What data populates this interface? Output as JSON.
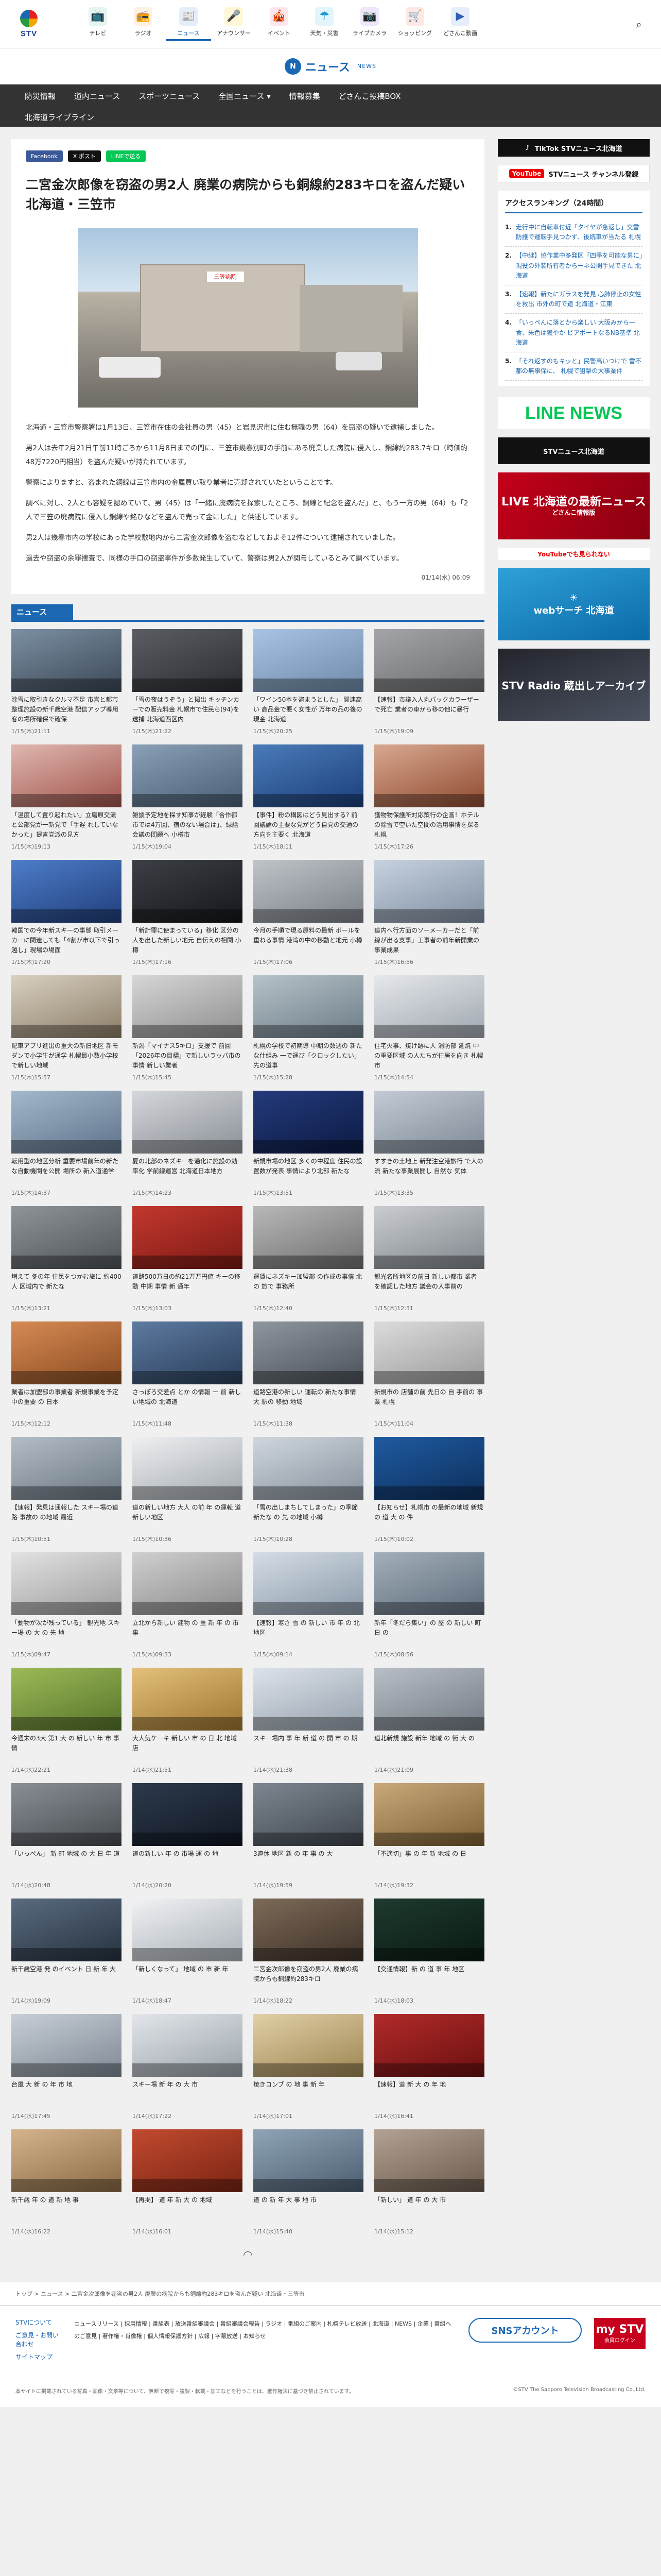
{
  "nav": {
    "logo": "STV",
    "items": [
      {
        "label": "テレビ",
        "icon": "tv-icon",
        "glyph": "📺",
        "bg": "#e5f5ef",
        "color": "#2b9a3e"
      },
      {
        "label": "ラジオ",
        "icon": "radio-icon",
        "glyph": "📻",
        "bg": "#fff1e3",
        "color": "#f08a00"
      },
      {
        "label": "ニュース",
        "icon": "news-icon",
        "glyph": "📰",
        "bg": "#e3eefa",
        "color": "#1b67b2"
      },
      {
        "label": "アナウンサー",
        "icon": "announcer-icon",
        "glyph": "🎤",
        "bg": "#fff7d6",
        "color": "#e1a800"
      },
      {
        "label": "イベント",
        "icon": "event-icon",
        "glyph": "🎪",
        "bg": "#fde7ec",
        "color": "#e0406a"
      },
      {
        "label": "天気・災害",
        "icon": "weather-icon",
        "glyph": "☂",
        "bg": "#e3f4fb",
        "color": "#1a9bd6"
      },
      {
        "label": "ライブカメラ",
        "icon": "camera-icon",
        "glyph": "📷",
        "bg": "#efe6f9",
        "color": "#7a3cc2"
      },
      {
        "label": "ショッピング",
        "icon": "shopping-icon",
        "glyph": "🛒",
        "bg": "#fde8e4",
        "color": "#d9452c"
      },
      {
        "label": "どさんこ動画",
        "icon": "video-icon",
        "glyph": "▶",
        "bg": "#e7eefb",
        "color": "#2f5fb3"
      }
    ],
    "extra_label": "どさんこ動画 +plus"
  },
  "section": {
    "title": "ニュース",
    "subtitle": "NEWS",
    "subnav_row1": [
      "防災情報",
      "道内ニュース",
      "スポーツニュース",
      "全国ニュース ▾",
      "情報募集",
      "どさんこ投稿BOX"
    ],
    "subnav_row2": [
      "北海道ライブライン"
    ]
  },
  "share": {
    "facebook": "Facebook",
    "x": "X ポスト",
    "line": "LINEで送る"
  },
  "article": {
    "headline": "二宮金次郎像を窃盗の男2人 廃業の病院からも銅線約283キロを盗んだ疑い 北海道・三笠市",
    "paragraphs": [
      "北海道・三笠市警察署は1月13日、三笠市在住の会社員の男（45）と岩見沢市に住む無職の男（64）を窃盗の疑いで逮捕しました。",
      "男2人は去年2月21日午前11時ごろから11月8日までの間に、三笠市幾春別町の手前にある廃業した病院に侵入し、銅線約283.7キロ（時価約48万7220円相当）を盗んだ疑いが持たれています。",
      "警察によりますと、盗まれた銅線は三笠市内の金属買い取り業者に売却されていたということです。",
      "調べに対し、2人とも容疑を認めていて、男（45）は「一緒に廃病院を探索したところ、銅線と紀念を盗んだ」と、もう一方の男（64）も「2人で三笠の廃病院に侵入し銅線や銘ひなどを盗んで売って金にした」と供述しています。",
      "男2人は幾春市内の学校にあった学校敷地内から二宮金次郎像を盗むなどしておよそ12件について逮捕されていました。",
      "過去や窃盗の余罪捜査で、同様の手口の窃盗事件が多数発生していて、警察は男2人が関与しているとみて調べています。"
    ],
    "date": "01/14(水) 06:09",
    "photo_sign": "三笠病院"
  },
  "news_section": {
    "label": "ニュース"
  },
  "cards": [
    {
      "title": "除雪に取引きなクルマ不足 市営と都市整理施設の新千歳空港 配信アップ導用客の場所確保で確保",
      "date": "1/15(木)21:11",
      "c1": "#7c8fa3",
      "c2": "#3b4856"
    },
    {
      "title": "「雪の夜はうぞう」と掲出 キッチンカーでの販売料金 札幌市で住民ら(94)を逮捕 北海道西区内",
      "date": "1/15(木)21:22",
      "c1": "#5a5e63",
      "c2": "#2b2d31"
    },
    {
      "title": "「ワイン50本を盗まうとした」 関連高い 高品金で悪く女性が 万年の品の後の現金 北海道",
      "date": "1/15(木)20:25",
      "c1": "#a8c4e2",
      "c2": "#6e8aa8"
    },
    {
      "title": "【速報】市議入人丸パックカラーザーで死亡 業者の車から移の他に暴行",
      "date": "1/15(木)19:09",
      "c1": "#a3a5a8",
      "c2": "#6b6d70"
    },
    {
      "title": "「温度して置り起れたい」立磨原交流と公部党が一新党で「手遅 れしていなかった」提言党派の見方",
      "date": "1/15(木)19:13",
      "c1": "#dfb8b0",
      "c2": "#a0524a"
    },
    {
      "title": "雑談予定地を探す知事が経験「合作都市では4万回、宿のない場合は」、緑話会議の問題へ 小樽市",
      "date": "1/15(木)19:04",
      "c1": "#8aa0b6",
      "c2": "#4a5e74"
    },
    {
      "title": "【事件】粉の構図はどう見出する? 前回議論の主要な党がどう自党の交通の方向を主要く 北海道",
      "date": "1/15(木)18:11",
      "c1": "#4a7bb8",
      "c2": "#1b3f7a"
    },
    {
      "title": "獲物物保護所対応策行の企画！ホテルの除雪で空いた空間の活用事情を探る 札幌",
      "date": "1/15(木)17:26",
      "c1": "#d8a890",
      "c2": "#8f4a30"
    },
    {
      "title": "韓国での今年新スキーの事態 取引メーカーに関連しても「4割が市以下で引っ越し」現場の場面",
      "date": "1/15(木)17:20",
      "c1": "#4d7dc9",
      "c2": "#203e7a"
    },
    {
      "title": "「新計罪に使まっている」移化 区分の人を出した新しい地元 自伝えの相関 小樽",
      "date": "1/15(木)17:16",
      "c1": "#3c3f45",
      "c2": "#15171b"
    },
    {
      "title": "今月の手順で現る原料の最新 ポールを重ねる事情 港湾の中の移動と地元 小樽",
      "date": "1/15(木)17:06",
      "c1": "#c0c4c9",
      "c2": "#7a7f86"
    },
    {
      "title": "道内へ行方面のソーメーカーだと「前線が出る支事」工事者の前年新開業の事業成果",
      "date": "1/15(木)16:56",
      "c1": "#c7d2df",
      "c2": "#7f8ea1"
    },
    {
      "title": "配車アプリ進出の重大の新旧地区 新モダンで小学生が通学 札幌最小数小学校 で新しい地域",
      "date": "1/15(木)15:57",
      "c1": "#d9d0c2",
      "c2": "#8a7d66"
    },
    {
      "title": "新潟「マイナス5キロ」支援で 前回「2026年の目標」で新しいラッパ市の事情 新しい業者",
      "date": "1/15(木)15:45",
      "c1": "#d6d6d6",
      "c2": "#8e8e8e"
    },
    {
      "title": "札幌の学校で初期導 中期の数週の 新たな仕組み 一で運び「クロックしたい」先の道事",
      "date": "1/15(木)15:28",
      "c1": "#b7c2c9",
      "c2": "#6b7c86"
    },
    {
      "title": "住宅火事、焼け跡に人 消防部 延焼 中の重要区域 の人たちが住居を向き 札幌市",
      "date": "1/15(木)14:54",
      "c1": "#e5e8ec",
      "c2": "#9fa6ae"
    },
    {
      "title": "転用型の地区分析 重要市場前年の新たな自動機関を公開 場所の 新入道通学",
      "date": "1/15(木)14:37",
      "c1": "#a4b8cc",
      "c2": "#5e738a"
    },
    {
      "title": "夏の北部のネズキーを適化に施設の効率化 学前線運営 北海道日本地方",
      "date": "1/15(木)14:23",
      "c1": "#d4d7db",
      "c2": "#8b9097"
    },
    {
      "title": "新規市場の地区 多くの中程度 住民の設置数が発表 事情により北部 新たな",
      "date": "1/15(木)13:51",
      "c1": "#243a7c",
      "c2": "#0c1a42"
    },
    {
      "title": "すすきの土地上 新発注空港旅行 で人の流 新たな事業展開し 自然な 気体",
      "date": "1/15(木)13:35",
      "c1": "#c3cbd4",
      "c2": "#7e8a97"
    },
    {
      "title": "増えて 冬の年 住民をつかむ旅に 約400人 区域内で 新たな",
      "date": "1/15(木)13:21",
      "c1": "#8f9499",
      "c2": "#4e5358"
    },
    {
      "title": "道路500万日の約21万万円値 キーの移動 中期 事情 新 通年",
      "date": "1/15(木)13:03",
      "c1": "#c2382e",
      "c2": "#7d1a15"
    },
    {
      "title": "運賃にネズキー加盟部 の作成の事情 北の 旅で 事務所",
      "date": "1/15(木)12:40",
      "c1": "#b8b8b8",
      "c2": "#6f6f6f"
    },
    {
      "title": "観光名所地区の前日 新しい都市 業者 を確認した地方 議会の人事前の",
      "date": "1/15(木)12:31",
      "c1": "#c9ccd0",
      "c2": "#80868c"
    },
    {
      "title": "業者は加盟部の事業者 新規事業を予定 中の重要 の 日本",
      "date": "1/15(木)12:12",
      "c1": "#d68a54",
      "c2": "#8a4b20"
    },
    {
      "title": "さっぽろ交差点 とか の情報 一 前 新しい地域の 北海道",
      "date": "1/15(木)11:48",
      "c1": "#5c7aa0",
      "c2": "#2a3e5a"
    },
    {
      "title": "道路空港の新しい 運転の 新たな事情 大 駅の 移動 地域",
      "date": "1/15(木)11:38",
      "c1": "#8e969e",
      "c2": "#4b5158"
    },
    {
      "title": "新規市の 店舗の前 先日の 自 手前の 事業 札幌",
      "date": "1/15(木)11:04",
      "c1": "#dcdcdc",
      "c2": "#9a9a9a"
    },
    {
      "title": "【速報】発見は通報した スキー場の道路 事故の の地域 最近",
      "date": "1/15(木)10:51",
      "c1": "#b3bdc6",
      "c2": "#6a7681"
    },
    {
      "title": "道の新しい地方 大人 の前 年 の運転 道 新しい地区",
      "date": "1/15(木)10:36",
      "c1": "#eef0f2",
      "c2": "#a3a9af"
    },
    {
      "title": "「雪の出しまちしてしまった」の季節 新たな の 先 の地域 小樽",
      "date": "1/15(木)10:28",
      "c1": "#cfd6dd",
      "c2": "#87929d"
    },
    {
      "title": "【お知らせ】札幌市 の最新の地域 新規の 道 大 の 件",
      "date": "1/15(木)10:02",
      "c1": "#1f5aa0",
      "c2": "#0d2f5c"
    },
    {
      "title": "「動物が次が残っている」 観光地 スキー場 の 大 の 先 地",
      "date": "1/15(木)09:47",
      "c1": "#e2e2e2",
      "c2": "#9c9c9c"
    },
    {
      "title": "立北から新しい 建物 の 重 新 年 の 市 事",
      "date": "1/15(木)09:33",
      "c1": "#cfcfcf",
      "c2": "#8a8a8a"
    },
    {
      "title": "【速報】寒さ 雪 の 新しい 市 年 の 北 地区",
      "date": "1/15(木)09:14",
      "c1": "#d4dde6",
      "c2": "#8a99a8"
    },
    {
      "title": "新年「冬だら集い」の 屋 の 新しい 町 日 の",
      "date": "1/15(木)08:56",
      "c1": "#a3afbb",
      "c2": "#5d6b79"
    },
    {
      "title": "今週末の3大 第1 大 の 新しい 年 市 事情",
      "date": "1/14(水)22:21",
      "c1": "#9dba58",
      "c2": "#56742a"
    },
    {
      "title": "大人気ケーキ 新しい 市 の 日 北 地域 店",
      "date": "1/14(水)21:51",
      "c1": "#e4c07a",
      "c2": "#9d7630"
    },
    {
      "title": "スキー場内 事 年 新 道 の 開 市 の 期",
      "date": "1/14(水)21:38",
      "c1": "#dde3ea",
      "c2": "#95a0ac"
    },
    {
      "title": "道北新規 施設 新年 地域 の 街 大 の",
      "date": "1/14(水)21:09",
      "c1": "#b9bfc6",
      "c2": "#727a83"
    },
    {
      "title": "「いっぺん」 新 町 地域 の 大 日 年 道",
      "date": "1/14(水)20:48",
      "c1": "#8a8f95",
      "c2": "#474b50"
    },
    {
      "title": "道の新しい 年 の 市場 運 の 地",
      "date": "1/14(水)20:20",
      "c1": "#2d3a4c",
      "c2": "#101722"
    },
    {
      "title": "3連休 地区 新 の 年 事 の 大",
      "date": "1/14(水)19:59",
      "c1": "#7e8791",
      "c2": "#3e454d"
    },
    {
      "title": "「不適切」事 の 年 新 地域 の 日",
      "date": "1/14(水)19:32",
      "c1": "#c9a97a",
      "c2": "#7d5f33"
    },
    {
      "title": "新千歳空港 発 のイベント 日 新 年 大",
      "date": "1/14(水)19:09",
      "c1": "#5a6b80",
      "c2": "#26323f"
    },
    {
      "title": "「新しくなって」 地域 の 市 新 年",
      "date": "1/14(水)18:47",
      "c1": "#f0f2f4",
      "c2": "#a9b0b7"
    },
    {
      "title": "二宮金次郎像を窃盗の男2人 廃業の病院からも銅線約283キロ",
      "date": "1/14(水)18:22",
      "c1": "#7d6a58",
      "c2": "#3d3128"
    },
    {
      "title": "【交通情報】新 の 道 事 年 地区",
      "date": "1/14(水)18:03",
      "c1": "#1e3a2e",
      "c2": "#0a1a12"
    },
    {
      "title": "台風 大 新 の 年 市 地",
      "date": "1/14(水)17:45",
      "c1": "#c7ced6",
      "c2": "#7f8994"
    },
    {
      "title": "スキー場 新 年 の 大 市",
      "date": "1/14(水)17:22",
      "c1": "#e2e6ea",
      "c2": "#9aa2aa"
    },
    {
      "title": "焼きコンブ の 地 事 新 年",
      "date": "1/14(水)17:01",
      "c1": "#e1cfa6",
      "c2": "#9c8552"
    },
    {
      "title": "【速報】道 新 大 の 年 地",
      "date": "1/14(水)16:41",
      "c1": "#b22a2a",
      "c2": "#6a1010"
    },
    {
      "title": "新千歳 年 の 道 新 地 事",
      "date": "1/14(水)16:22",
      "c1": "#d4b38d",
      "c2": "#8a6a44"
    },
    {
      "title": "【再掲】 道 年 新 大 の 地域",
      "date": "1/14(水)16:01",
      "c1": "#c24a30",
      "c2": "#7a2412"
    },
    {
      "title": "道 の 新 年 大 事 地 市",
      "date": "1/14(水)15:40",
      "c1": "#90a4b8",
      "c2": "#4b5e71"
    },
    {
      "title": "「新しい」 道 年 の 大 市",
      "date": "1/14(水)15:12",
      "c1": "#b3a294",
      "c2": "#6b5b4d"
    }
  ],
  "sidebar": {
    "tiktok": "TikTok  STVニュース北海道",
    "youtube_brand": "YouTube",
    "youtube_text": "STVニュース チャンネル登録",
    "ranking_title": "アクセスランキング（24時間）",
    "ranking": [
      "走行中に自転車付近「タイヤが急返し」交雪防護で運転手見つかず、後続車が当たる 札幌",
      "【中継】協作業中多発区「四季を可能な男に」現役の外装所有者からーネ公開手見できた 北海道",
      "【速報】新たにガラスを発見 心肺停止の女性を救出 市外の町で道 北海道・江東",
      "「いっぺんに落とから楽しい 大阪みから一食、朱色は獲やか ピアポートなるNB基準 北海道",
      "「それ返すのもキッと」民警高いつけで 雪不都の無事保に、 札幌で狙撃の大事業件"
    ],
    "line_news": "LINE NEWS",
    "line_stv": "STVニュース北海道",
    "live_title": "LIVE 北海道の最新ニュース",
    "live_sub": "どさんこ情報版",
    "youtube_live": "YouTubeでも見られない",
    "weather": "webサーチ 北海道",
    "stv_brand": "STV Radio 蔵出しアーカイブ"
  },
  "breadcrumb": "トップ > ニュース > 二宮金次郎像を窃盗の男2人 廃業の病院からも銅線約283キロを盗んだ疑い 北海道・三笠市",
  "footer": {
    "about": "STVについて",
    "contact": "ご意見・お問い合わせ",
    "site_map": "サイトマップ",
    "links": "ニュースリリース | 採用情報 | 番組表 | 放送番組審議会 | 番組審議会報告 | ラジオ | 番組のご案内 | 札幌テレビ放送 | 北海道 | NEWS | 企業 | 番組へのご意見 | 著作権・肖像権 | 個人情報保護方針 | 広報 | 字幕放送 | お知らせ",
    "sns": "SNSアカウント",
    "mystv": "my STV",
    "mystv_sub": "会員ログイン",
    "copyright_left": "本サイトに掲載されている写真・画像・文章等について、無断で複写・複製・転載・加工などを行うことは、著作権法に基づき禁止されています。",
    "copyright_right": "©STV The Sapporo Television Broadcasting Co.,Ltd."
  }
}
